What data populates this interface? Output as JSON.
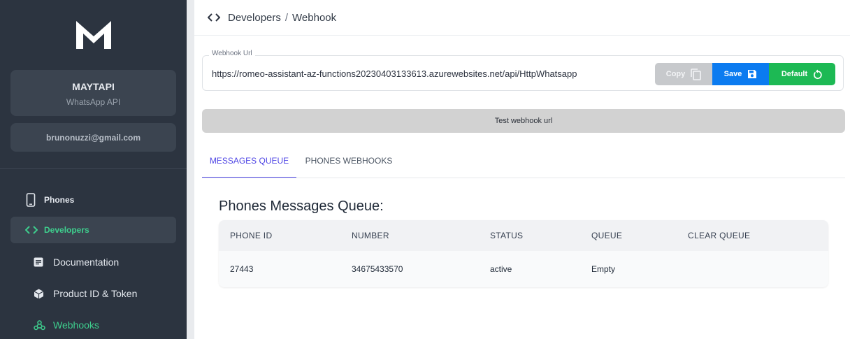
{
  "sidebar": {
    "brand_name": "MAYTAPI",
    "brand_sub": "WhatsApp API",
    "account_email": "brunonuzzi@gmail.com",
    "items": [
      {
        "label": "Phones",
        "icon": "phone-icon"
      },
      {
        "label": "Developers",
        "icon": "code-icon",
        "active": true
      }
    ],
    "subitems": [
      {
        "label": "Documentation",
        "icon": "document-icon"
      },
      {
        "label": "Product ID & Token",
        "icon": "cube-icon"
      },
      {
        "label": "Webhooks",
        "icon": "webhook-icon",
        "active": true
      }
    ]
  },
  "breadcrumb": {
    "section": "Developers",
    "separator": "/",
    "page": "Webhook"
  },
  "webhook": {
    "legend": "Webhook Url",
    "url": "https://romeo-assistant-az-functions20230403133613.azurewebsites.net/api/HttpWhatsapp",
    "copy_label": "Copy",
    "save_label": "Save",
    "default_label": "Default",
    "test_label": "Test webhook url"
  },
  "tabs": [
    {
      "label": "MESSAGES QUEUE",
      "active": true
    },
    {
      "label": "PHONES WEBHOOKS",
      "active": false
    }
  ],
  "queue": {
    "title": "Phones Messages Queue:",
    "columns": [
      "PHONE ID",
      "NUMBER",
      "STATUS",
      "QUEUE",
      "CLEAR QUEUE"
    ],
    "rows": [
      {
        "phone_id": "27443",
        "number": "34675433570",
        "status": "active",
        "queue": "Empty",
        "clear_queue": ""
      }
    ]
  },
  "colors": {
    "sidebar_bg": "#2c3440",
    "accent_green": "#3ecf8e",
    "tab_active": "#4f46e5",
    "save_blue": "#0b7bf0",
    "default_green": "#1db954"
  }
}
